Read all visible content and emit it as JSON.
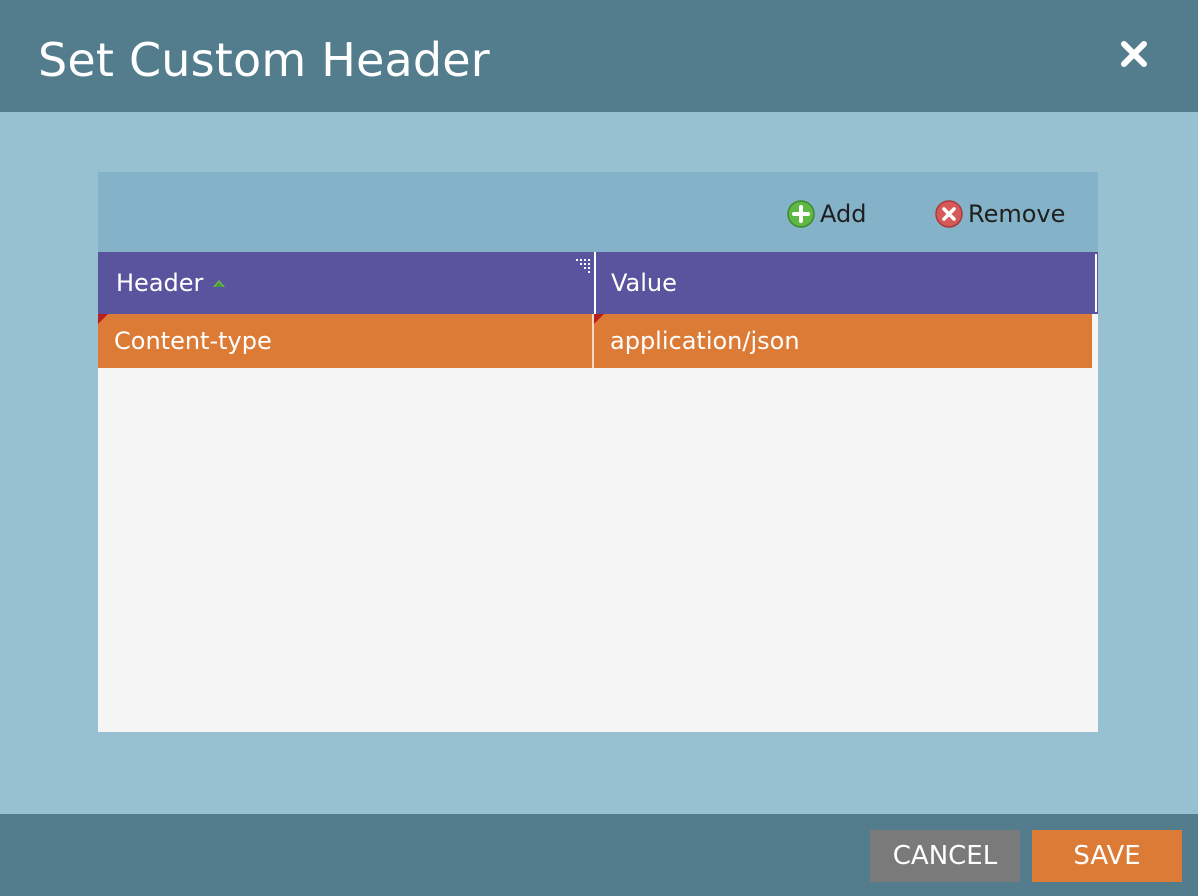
{
  "dialog": {
    "title": "Set Custom Header",
    "close_icon": "close-icon"
  },
  "toolbar": {
    "add_label": "Add",
    "add_icon": "plus-circle-icon",
    "remove_label": "Remove",
    "remove_icon": "x-circle-icon"
  },
  "grid": {
    "columns": [
      {
        "label": "Header",
        "sort_icon": "sort-indicator-icon"
      },
      {
        "label": "Value"
      }
    ],
    "rows": [
      {
        "header": "Content-type",
        "value": "application/json",
        "selected": true
      }
    ]
  },
  "footer": {
    "cancel_label": "CANCEL",
    "save_label": "SAVE"
  },
  "colors": {
    "titlebar": "#537d8d",
    "content_bg": "#97c1d1",
    "toolbar_bg": "#84b2c8",
    "column_header_bg": "#5a549e",
    "selected_row_bg": "#dc7b36",
    "cancel_bg": "#7a7a7a",
    "save_bg": "#dc7b36"
  }
}
